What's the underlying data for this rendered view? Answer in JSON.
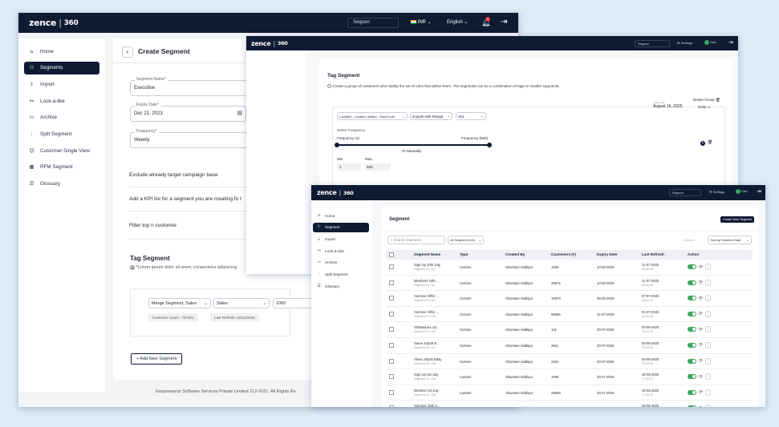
{
  "win1": {
    "logo": "zence",
    "logo_sep": "|",
    "logo_num": "360",
    "nav": {
      "store": "Segoon",
      "currency": "INR",
      "language": "English",
      "bell_count": "0"
    },
    "sidebar": [
      {
        "label": "Home",
        "icon": "home-icon"
      },
      {
        "label": "Segments",
        "icon": "segments-icon"
      },
      {
        "label": "Import",
        "icon": "import-icon"
      },
      {
        "label": "Look-a-like",
        "icon": "lookalike-icon"
      },
      {
        "label": "Archive",
        "icon": "archive-icon"
      },
      {
        "label": "Split Segment",
        "icon": "split-icon"
      },
      {
        "label": "Customer Single View",
        "icon": "user-icon"
      },
      {
        "label": "RFM Segment",
        "icon": "rfm-icon"
      },
      {
        "label": "Glossary",
        "icon": "glossary-icon"
      }
    ],
    "page_title": "Create Segment",
    "segment_name_label": "Segment Name*",
    "segment_name_value": "Executive",
    "expiry_label": "Expiry Date*",
    "expiry_value": "Dec 21, 2023",
    "frequency_label": "Frequency*",
    "frequency_value": "Weekly",
    "exclude_text": "Exclude already target campaign base",
    "kpi_text": "Add a KPI list for a segment you are creating fo t",
    "filter_text": "Filter top n customer",
    "tag_title": "Tag Segment",
    "tag_desc": "*Lorem ipsum dolor sit amet, consectetur adipiscing",
    "rule_sel1": "Merge Segment, Sales",
    "rule_sel2": "Sales",
    "rule_value": "1000",
    "customer_count": "Customer Count : 757221",
    "last_refresh": "Last Refresh: 12/12/2023",
    "add_new": "+ Add New Segment",
    "footer": "Easyrewardz Software Services Private Limited 212-2021. All Rights Re"
  },
  "win2": {
    "logo": "zence",
    "logo_sep": "|",
    "logo_num": "360",
    "nav": {
      "store": "Segoon",
      "settings": "Settings",
      "user": "Cart"
    },
    "tag_title": "Tag Segment",
    "tag_desc": "Create a group of customers who satisfy the set of rules that define them. The segments can be a combination of tags or smaller segments.",
    "start_date_label": "Start Date",
    "start_date": "August 16, 2025",
    "frequency": "Daily",
    "delete_group": "Delete Group",
    "sel_location": "Location : Location Visited : StoreCode",
    "sel_range": "Equals with Range",
    "sel_value": "101",
    "select_frequency": "Select Frequency",
    "freq_min_label": "Frequency (1)",
    "freq_max_label": "Frequency (500)",
    "or_manually": "Or Manually",
    "min_label": "Min.",
    "max_label": "Max.",
    "min_value": "1",
    "max_value": "500"
  },
  "win3": {
    "logo": "zence",
    "logo_sep": "|",
    "logo_num": "360",
    "nav": {
      "store": "Segoon",
      "settings": "Settings",
      "user": "Cart"
    },
    "sidebar": [
      {
        "label": "Home",
        "icon": "home-icon"
      },
      {
        "label": "Segment",
        "icon": "segments-icon"
      },
      {
        "label": "Import",
        "icon": "import-icon"
      },
      {
        "label": "Look-a-Like",
        "icon": "lookalike-icon"
      },
      {
        "label": "Archive",
        "icon": "archive-icon"
      },
      {
        "label": "Split Segment",
        "icon": "split-icon"
      },
      {
        "label": "Glossary",
        "icon": "glossary-icon"
      }
    ],
    "title": "Segment",
    "create_button": "Create New Segment",
    "search_placeholder": "Search Segments",
    "filter_all": "All Segment (111)",
    "archive_label": "Archive",
    "sort_label": "Sort by Creation Date",
    "columns": [
      "Segment Name",
      "Type",
      "Created By",
      "Customers (#)",
      "Expiry Date",
      "Last Refresh",
      "Action"
    ],
    "rows": [
      {
        "name": "Sign Up 10th July",
        "id": "Segment ID: 112",
        "type": "Custom",
        "by": "Shamsan Siddiqui",
        "customers": "1905",
        "expiry": "10-08-2025",
        "refresh": "11-07-2025",
        "time": "16:48:38"
      },
      {
        "name": "Members 10th ...",
        "id": "Segment ID: 111",
        "type": "Custom",
        "by": "Shamsan Siddiqui",
        "customers": "28674",
        "expiry": "10-08-2025",
        "refresh": "11-07-2025",
        "time": "16:40:26"
      },
      {
        "name": "Summer Offer ...",
        "id": "Segment ID: 110",
        "type": "Custom",
        "by": "Shamsan Siddiqui",
        "customers": "10870",
        "expiry": "06-08-2025",
        "refresh": "07-07-2025",
        "time": "20:53:02"
      },
      {
        "name": "Summer Offer ...",
        "id": "Segment ID: 109",
        "type": "Custom",
        "by": "Shamsan Siddiqui",
        "customers": "55885",
        "expiry": "31-07-2025",
        "refresh": "01-07-2025",
        "time": "19:54:06"
      },
      {
        "name": "Shabaduna Jul...",
        "id": "Segment ID: 108",
        "type": "Custom",
        "by": "Shamsan Siddiqui",
        "customers": "131",
        "expiry": "30-07-2025",
        "refresh": "30-06-2025",
        "time": "18:51:23"
      },
      {
        "name": "Same July25 B...",
        "id": "Segment ID: 107",
        "type": "Custom",
        "by": "Shamsan Siddiqui",
        "customers": "2811",
        "expiry": "30-07-2025",
        "refresh": "30-06-2025",
        "time": "18:08:00"
      },
      {
        "name": "Alexa July25 Bday",
        "id": "Segment ID: 106",
        "type": "Custom",
        "by": "Shamsan Siddiqui",
        "customers": "2251",
        "expiry": "30-07-2025",
        "refresh": "30-06-2025",
        "time": "18:05:55"
      },
      {
        "name": "Sign Up 1st July",
        "id": "Segment ID: 105",
        "type": "Custom",
        "by": "Shamsan Siddiqui",
        "customers": "1905",
        "expiry": "30-07-2025",
        "refresh": "30-06-2025",
        "time": "17:53:22"
      },
      {
        "name": "Member 1st July",
        "id": "Segment ID: 104",
        "type": "Custom",
        "by": "Shamsan Siddiqui",
        "customers": "28669",
        "expiry": "30-07-2025",
        "refresh": "30-06-2025",
        "time": "17:48:09"
      },
      {
        "name": "Summer 25th S...",
        "id": "Segment ID: 103",
        "type": "Custom",
        "by": "Shamsan Siddiqui",
        "customers": "",
        "expiry": "",
        "refresh": "26-06-2025",
        "time": ""
      }
    ]
  },
  "colors": {
    "navy": "#0f1b33",
    "green": "#3aa55d",
    "bg": "#dcebf6"
  }
}
